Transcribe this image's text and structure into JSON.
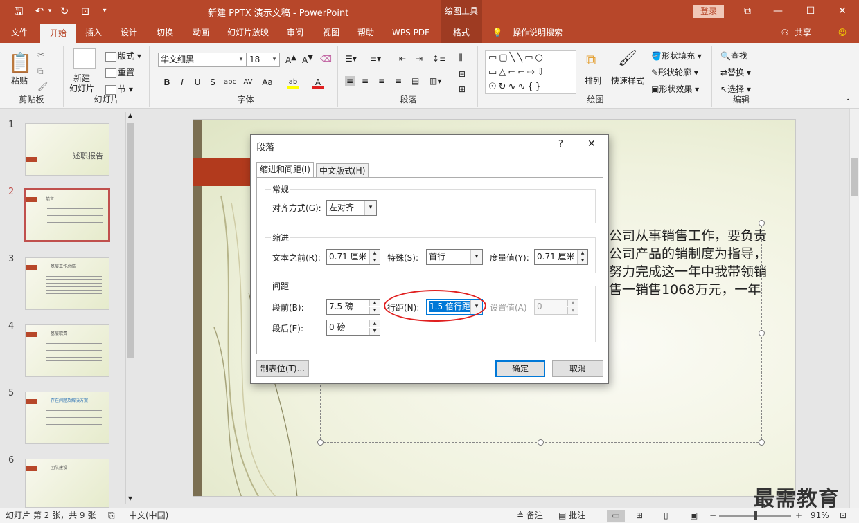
{
  "titlebar": {
    "doc_title": "新建 PPTX 演示文稿 - PowerPoint",
    "context_tool": "绘图工具",
    "login": "登录"
  },
  "tabs": [
    "文件",
    "开始",
    "插入",
    "设计",
    "切换",
    "动画",
    "幻灯片放映",
    "审阅",
    "视图",
    "帮助",
    "WPS PDF",
    "格式"
  ],
  "tell_me": "操作说明搜索",
  "share": "共享",
  "ribbon": {
    "clipboard": {
      "paste": "粘贴",
      "label": "剪贴板"
    },
    "slides": {
      "new_slide": "新建\n幻灯片",
      "layout": "版式",
      "reset": "重置",
      "section": "节",
      "label": "幻灯片"
    },
    "font": {
      "font_name": "华文细黑",
      "font_size": "18",
      "label": "字体",
      "bold": "B",
      "italic": "I",
      "underline": "U",
      "shadow": "S",
      "strike": "abc",
      "case": "Aa"
    },
    "paragraph": {
      "label": "段落"
    },
    "drawing": {
      "arrange": "排列",
      "quick_styles": "快速样式",
      "fill": "形状填充",
      "outline": "形状轮廓",
      "effects": "形状效果",
      "label": "绘图"
    },
    "editing": {
      "find": "查找",
      "replace": "替换",
      "select": "选择",
      "label": "编辑"
    }
  },
  "slides": [
    {
      "num": "1",
      "title": "述职报告"
    },
    {
      "num": "2",
      "title": "前言"
    },
    {
      "num": "3",
      "title": "基层工作总结"
    },
    {
      "num": "4",
      "title": "基层职责"
    },
    {
      "num": "5",
      "title": "存在问题及解决方案"
    },
    {
      "num": "6",
      "title": "团队建设"
    }
  ],
  "slide_text": "公司从事销售工作，要负责公司产品的销制度为指导，努力完成这一年中我带领销售一销售1068万元，一年",
  "dialog": {
    "title": "段落",
    "help": "?",
    "close": "✕",
    "tabs": [
      "缩进和间距(I)",
      "中文版式(H)"
    ],
    "general": {
      "title": "常规",
      "align_label": "对齐方式(G):",
      "align_value": "左对齐"
    },
    "indent": {
      "title": "缩进",
      "before_label": "文本之前(R):",
      "before_value": "0.71 厘米",
      "special_label": "特殊(S):",
      "special_value": "首行",
      "by_label": "度量值(Y):",
      "by_value": "0.71 厘米"
    },
    "spacing": {
      "title": "间距",
      "before_label": "段前(B):",
      "before_value": "7.5 磅",
      "after_label": "段后(E):",
      "after_value": "0 磅",
      "line_label": "行距(N):",
      "line_value": "1.5 倍行距",
      "at_label": "设置值(A)",
      "at_value": "0"
    },
    "tabs_button": "制表位(T)...",
    "ok": "确定",
    "cancel": "取消"
  },
  "status": {
    "slide_info": "幻灯片 第 2 张，共 9 张",
    "language": "中文(中国)",
    "notes": "备注",
    "comments": "批注",
    "zoom": "91%"
  },
  "watermark": "最需教育",
  "colors": {
    "accent": "#b7472a",
    "annotation": "#e02020",
    "selection": "#0078d7"
  }
}
